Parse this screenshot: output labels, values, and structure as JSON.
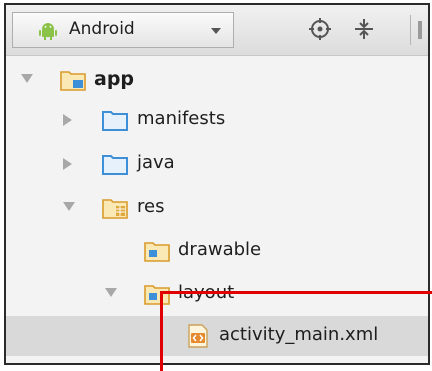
{
  "toolbar": {
    "view_label": "Android",
    "icons": [
      "android-icon",
      "chevron-down-icon",
      "crosshair-icon",
      "collapse-icon"
    ]
  },
  "tree": {
    "app": "app",
    "manifests": "manifests",
    "java": "java",
    "res": "res",
    "drawable": "drawable",
    "layout": "layout",
    "activity_main": "activity_main.xml"
  },
  "colors": {
    "folder": "#3d8fd8",
    "app_folder": "#e0a73a",
    "res_folder": "#d9a84a",
    "highlight": "#e00000",
    "selected_row": "#d9d9d9"
  }
}
